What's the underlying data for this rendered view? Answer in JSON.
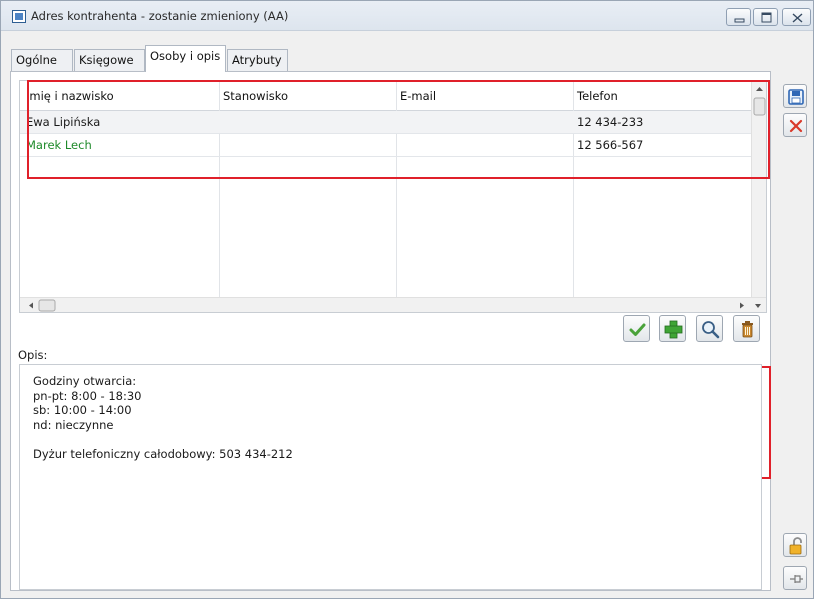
{
  "window": {
    "title": "Adres kontrahenta - zostanie zmieniony (AA)"
  },
  "tabs": [
    {
      "label": "Ogólne",
      "active": false
    },
    {
      "label": "Księgowe",
      "active": false
    },
    {
      "label": "Osoby i opis",
      "active": true
    },
    {
      "label": "Atrybuty",
      "active": false
    }
  ],
  "grid": {
    "columns": [
      "Imię i nazwisko",
      "Stanowisko",
      "E-mail",
      "Telefon"
    ],
    "rows": [
      {
        "name": "Ewa Lipińska",
        "position": "",
        "email": "",
        "phone": "12 434-233",
        "color": "#1a1a1a"
      },
      {
        "name": "Marek Lech",
        "position": "",
        "email": "",
        "phone": "12 566-567",
        "color": "#1e8a2a"
      }
    ]
  },
  "actions": {
    "confirm_icon": "check-icon",
    "add_icon": "plus-icon",
    "search_icon": "magnifier-icon",
    "delete_icon": "trash-icon"
  },
  "opis": {
    "label": "Opis:",
    "text": "Godziny otwarcia:\npn-pt: 8:00 - 18:30\nsb: 10:00 - 14:00\nnd: nieczynne\n\nDyżur telefoniczny całodobowy: 503 434-212"
  },
  "side": {
    "save_icon": "floppy-save-icon",
    "cancel_icon": "close-x-icon",
    "lock_icon": "padlock-icon",
    "pin_icon": "pin-icon"
  },
  "colors": {
    "highlight": "#e0202a",
    "accent_green": "#1e8a2a"
  }
}
